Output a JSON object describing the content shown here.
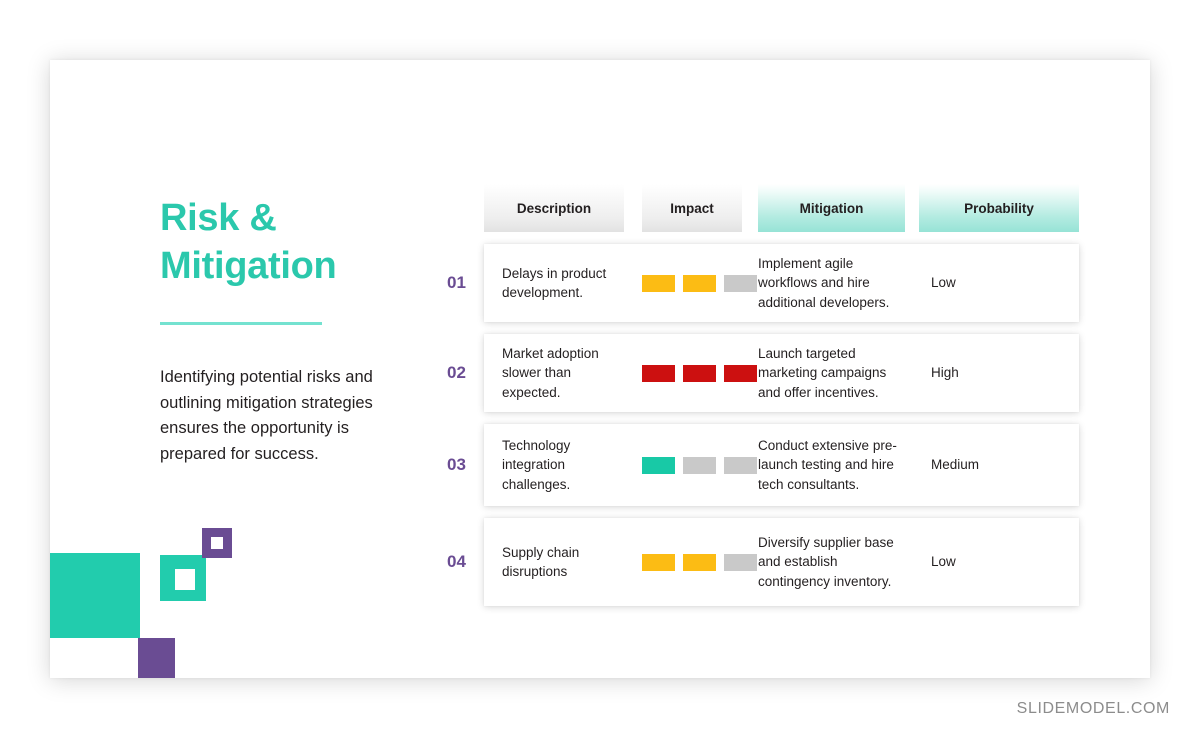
{
  "slide": {
    "title": "Risk &\nMitigation",
    "title_line1": "Risk &",
    "title_line2": "Mitigation",
    "intro": "Identifying potential risks and outlining mitigation strategies ensures the opportunity is prepared for success.",
    "watermark": "SLIDEMODEL.COM",
    "colors": {
      "teal": "#22CCAD",
      "teal_title": "#2BC8AC",
      "teal_divider": "#74E2D0",
      "purple": "#6A4C93",
      "bar_yellow": "#FCBC14",
      "bar_red": "#CC1010",
      "bar_teal": "#18C9A6",
      "bar_gray": "#C9C9C9",
      "text": "#231F20",
      "watermark": "#8C8C8C"
    }
  },
  "table": {
    "headers": [
      {
        "label": "Description",
        "style": "gray"
      },
      {
        "label": "Impact",
        "style": "gray"
      },
      {
        "label": "Mitigation",
        "style": "teal"
      },
      {
        "label": "Probability",
        "style": "teal"
      }
    ],
    "rows": [
      {
        "number": "01",
        "description": "Delays in product development.",
        "impact_bars": [
          "yellow",
          "yellow",
          "gray"
        ],
        "impact_level": 2,
        "mitigation": "Implement agile workflows and hire additional developers.",
        "probability": "Low"
      },
      {
        "number": "02",
        "description": "Market adoption slower than expected.",
        "impact_bars": [
          "red",
          "red",
          "red"
        ],
        "impact_level": 3,
        "mitigation": "Launch targeted marketing campaigns and offer incentives.",
        "probability": "High"
      },
      {
        "number": "03",
        "description": "Technology integration challenges.",
        "impact_bars": [
          "teal",
          "gray",
          "gray"
        ],
        "impact_level": 1,
        "mitigation": "Conduct extensive pre-launch testing and hire tech consultants.",
        "probability": "Medium"
      },
      {
        "number": "04",
        "description": "Supply chain disruptions",
        "impact_bars": [
          "yellow",
          "yellow",
          "gray"
        ],
        "impact_level": 2,
        "mitigation": "Diversify supplier base and establish contingency inventory.",
        "probability": "Low"
      }
    ]
  },
  "decorations": [
    {
      "name": "teal-square-large",
      "color": "#22CCAD"
    },
    {
      "name": "teal-ring-square",
      "color": "#22CCAD"
    },
    {
      "name": "purple-ring-square",
      "color": "#6A4C93"
    },
    {
      "name": "purple-square-small",
      "color": "#6A4C93"
    }
  ]
}
